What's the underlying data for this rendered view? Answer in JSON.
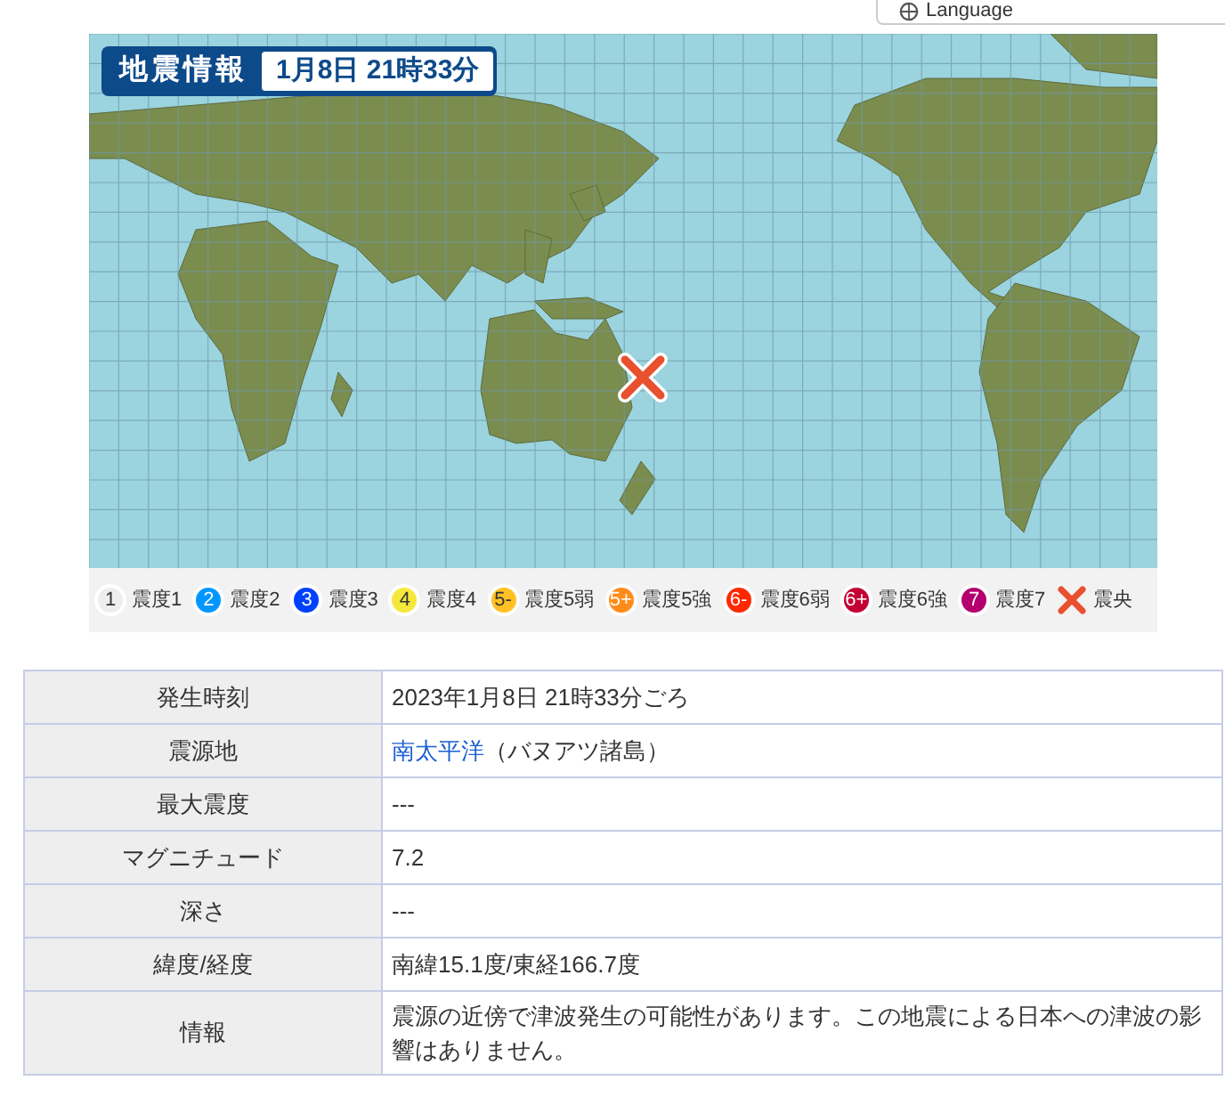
{
  "language_button": {
    "label": "Language"
  },
  "map": {
    "title": "地震情報",
    "datetime": "1月8日 21時33分"
  },
  "legend": [
    {
      "kind": "circle",
      "symbol": "1",
      "label": "震度1",
      "color": "#eeeeee"
    },
    {
      "kind": "circle",
      "symbol": "2",
      "label": "震度2",
      "color": "#0096ff"
    },
    {
      "kind": "circle",
      "symbol": "3",
      "label": "震度3",
      "color": "#0041ff"
    },
    {
      "kind": "circle",
      "symbol": "4",
      "label": "震度4",
      "color": "#f5e83a"
    },
    {
      "kind": "circle",
      "symbol": "5-",
      "label": "震度5弱",
      "color": "#ffc125"
    },
    {
      "kind": "circle",
      "symbol": "5+",
      "label": "震度5強",
      "color": "#ff8c1a"
    },
    {
      "kind": "circle",
      "symbol": "6-",
      "label": "震度6弱",
      "color": "#ff2800"
    },
    {
      "kind": "circle",
      "symbol": "6+",
      "label": "震度6強",
      "color": "#c30033"
    },
    {
      "kind": "circle",
      "symbol": "7",
      "label": "震度7",
      "color": "#b4006e"
    },
    {
      "kind": "cross",
      "label": "震央",
      "color": "#e8502e"
    }
  ],
  "table": {
    "rows": [
      {
        "label": "発生時刻",
        "value": "2023年1月8日 21時33分ごろ"
      },
      {
        "label": "震源地",
        "value": "南太平洋",
        "suffix": "（バヌアツ諸島）",
        "link": true
      },
      {
        "label": "最大震度",
        "value": "---"
      },
      {
        "label": "マグニチュード",
        "value": "7.2"
      },
      {
        "label": "深さ",
        "value": "---"
      },
      {
        "label": "緯度/経度",
        "value": "南緯15.1度/東経166.7度"
      },
      {
        "label": "情報",
        "value": "震源の近傍で津波発生の可能性があります。この地震による日本への津波の影響はありません。"
      }
    ]
  }
}
